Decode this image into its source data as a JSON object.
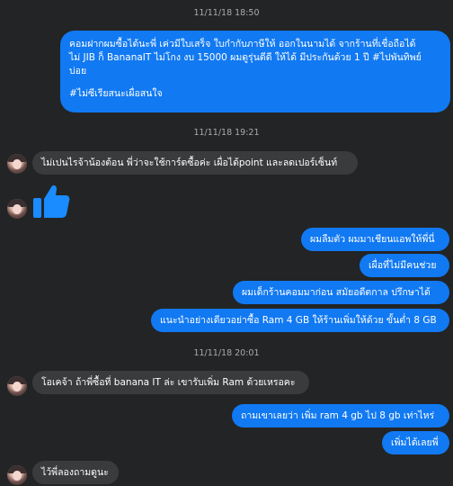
{
  "conversation": {
    "timestamps": [
      "11/11/18 18:50",
      "11/11/18 19:21",
      "11/11/18 20:01"
    ],
    "messages": {
      "m1_line1": "คอมฝากผมซื้อได้นะพี่ เค่วมีใบเสร็จ ใบกำกับภาษีให้ ออกในนามได้ จากร้านที่เชื่อถือได้",
      "m1_line2": "ไม่ JIB ก็ BananaIT ไม่โกง งบ 15000 ผมดูรุ่นดีดี ให้ได้ มีประกันด้วย 1 ปี  #ไปพันทิพย์",
      "m1_line3": "บ่อย",
      "m1_line4": "#ไม่ซีเรียสนะเผื่อสนใจ",
      "m2": "ไม่เปนไรจ้าน้องต้อน พี่ว่าจะใช้การ์ดซื้อค่ะ เผื่อได้point และลดเปอร์เซ็นท์",
      "m4": "ผมลืมตัว ผมมาเชียนแอพให้พี่นี่",
      "m5": "เผื่อที่ไม่มีคนช่วย",
      "m6": "ผมเด็กร้านคอมมาก่อน สมัยอดีตกาล ปรึกษาได้",
      "m7": "แนะนำอย่างเดียวอย่าซื้อ Ram 4 GB ให้ร้านเพิ่มให้ด้วย ขั้นต่ำ 8 GB",
      "m8": "โอเคจ้า ถ้าพี่ซื้อที่ banana IT ล่ะ เขารับเพิ่ม Ram ด้วยเหรอคะ",
      "m9": "ถามเขาเลยว่า เพิ่ม ram 4 gb ไป 8 gb เท่าไหร่",
      "m10": "เพิ่มได้เลยพี่",
      "m11": "ไว้พี่ลองถามดูนะ"
    },
    "icons": {
      "thumb": "thumbs-up-icon",
      "avatar": "avatar"
    },
    "colors": {
      "background": "#232425",
      "outgoing": "#1179f2",
      "incoming": "#3a3b3c",
      "timestamp": "#a9abaf"
    }
  }
}
